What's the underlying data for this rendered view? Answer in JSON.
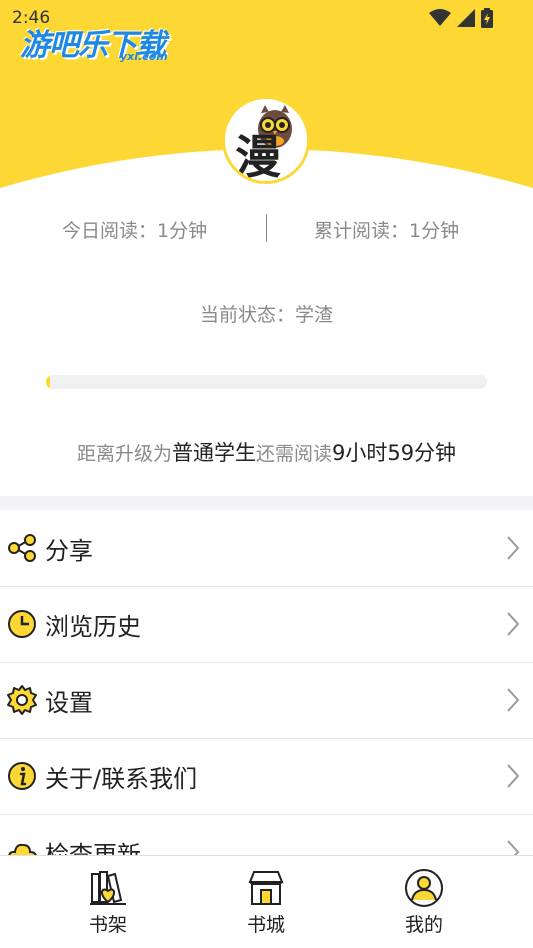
{
  "status_bar": {
    "time": "2:46"
  },
  "watermark": {
    "text": "游吧乐下载",
    "sub": "yxl.com"
  },
  "avatar": {
    "glyph": "漫"
  },
  "stats": {
    "today": "今日阅读：1分钟",
    "total": "累计阅读：1分钟"
  },
  "status": {
    "text": "当前状态：学渣"
  },
  "progress": {
    "fraction": 0.01
  },
  "upgrade": {
    "prefix": "距离升级为",
    "level": "普通学生",
    "middle": "还需阅读",
    "time": "9小时59分钟"
  },
  "menu": {
    "items": [
      {
        "label": "分享",
        "icon": "share-icon"
      },
      {
        "label": "浏览历史",
        "icon": "clock-icon"
      },
      {
        "label": "设置",
        "icon": "gear-icon"
      },
      {
        "label": "关于/联系我们",
        "icon": "info-icon"
      },
      {
        "label": "检查更新",
        "icon": "cloud-icon"
      }
    ]
  },
  "bottom_nav": {
    "items": [
      {
        "label": "书架",
        "icon": "bookshelf-icon"
      },
      {
        "label": "书城",
        "icon": "bookstore-icon"
      },
      {
        "label": "我的",
        "icon": "profile-icon"
      }
    ]
  },
  "colors": {
    "accent": "#fdd835",
    "text_muted": "#8a8a8a"
  }
}
